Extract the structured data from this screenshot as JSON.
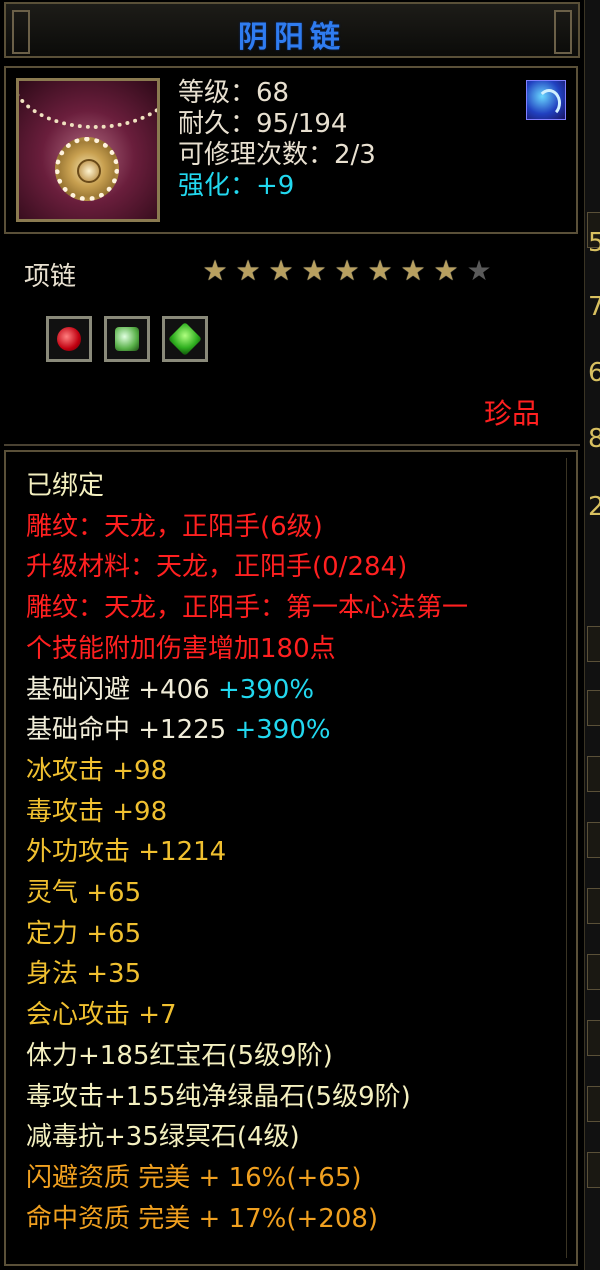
{
  "item": {
    "name": "阴阳链",
    "level": "等级：68",
    "durability": "耐久：95/194",
    "repair": "可修理次数：2/3",
    "enhance": "强化：+9",
    "type": "项链",
    "rarity": "珍品",
    "stars_total": 9,
    "stars_lit": 8,
    "gems": [
      "red-gem-icon",
      "green-crystal-gem-icon",
      "green-dark-gem-icon"
    ]
  },
  "attributes": {
    "bound": "已绑定",
    "engrave": "雕纹：天龙，正阳手(6级)",
    "material": "升级材料：天龙，正阳手(0/284)",
    "engrave_effect_1": "雕纹：天龙，正阳手：第一本心法第一",
    "engrave_effect_2": "个技能附加伤害增加180点",
    "dodge": "基础闪避 +406",
    "dodge_pct": "+390%",
    "hit": "基础命中 +1225",
    "hit_pct": "+390%",
    "ice_atk": "冰攻击 +98",
    "poison_atk": "毒攻击 +98",
    "outer_atk": "外功攻击 +1214",
    "spirit": "灵气 +65",
    "focus": "定力 +65",
    "agility": "身法 +35",
    "crit": "会心攻击 +7",
    "gem_line_1": "体力+185红宝石(5级9阶)",
    "gem_line_2": "毒攻击+155纯净绿晶石(5级9阶)",
    "gem_line_3": "减毒抗+35绿冥石(4级)",
    "aptitude_1": "闪避资质 完美 + 16%(+65)",
    "aptitude_2": "命中资质 完美 + 17%(+208)"
  },
  "side_fragments": [
    "5",
    "7",
    "6",
    "8",
    "2"
  ],
  "colors": {
    "title": "#2f7cf0",
    "cyan": "#22d8ef",
    "red": "#ff2020",
    "yellow": "#f0c030",
    "orange": "#f0a020",
    "frame": "#5a5038"
  }
}
